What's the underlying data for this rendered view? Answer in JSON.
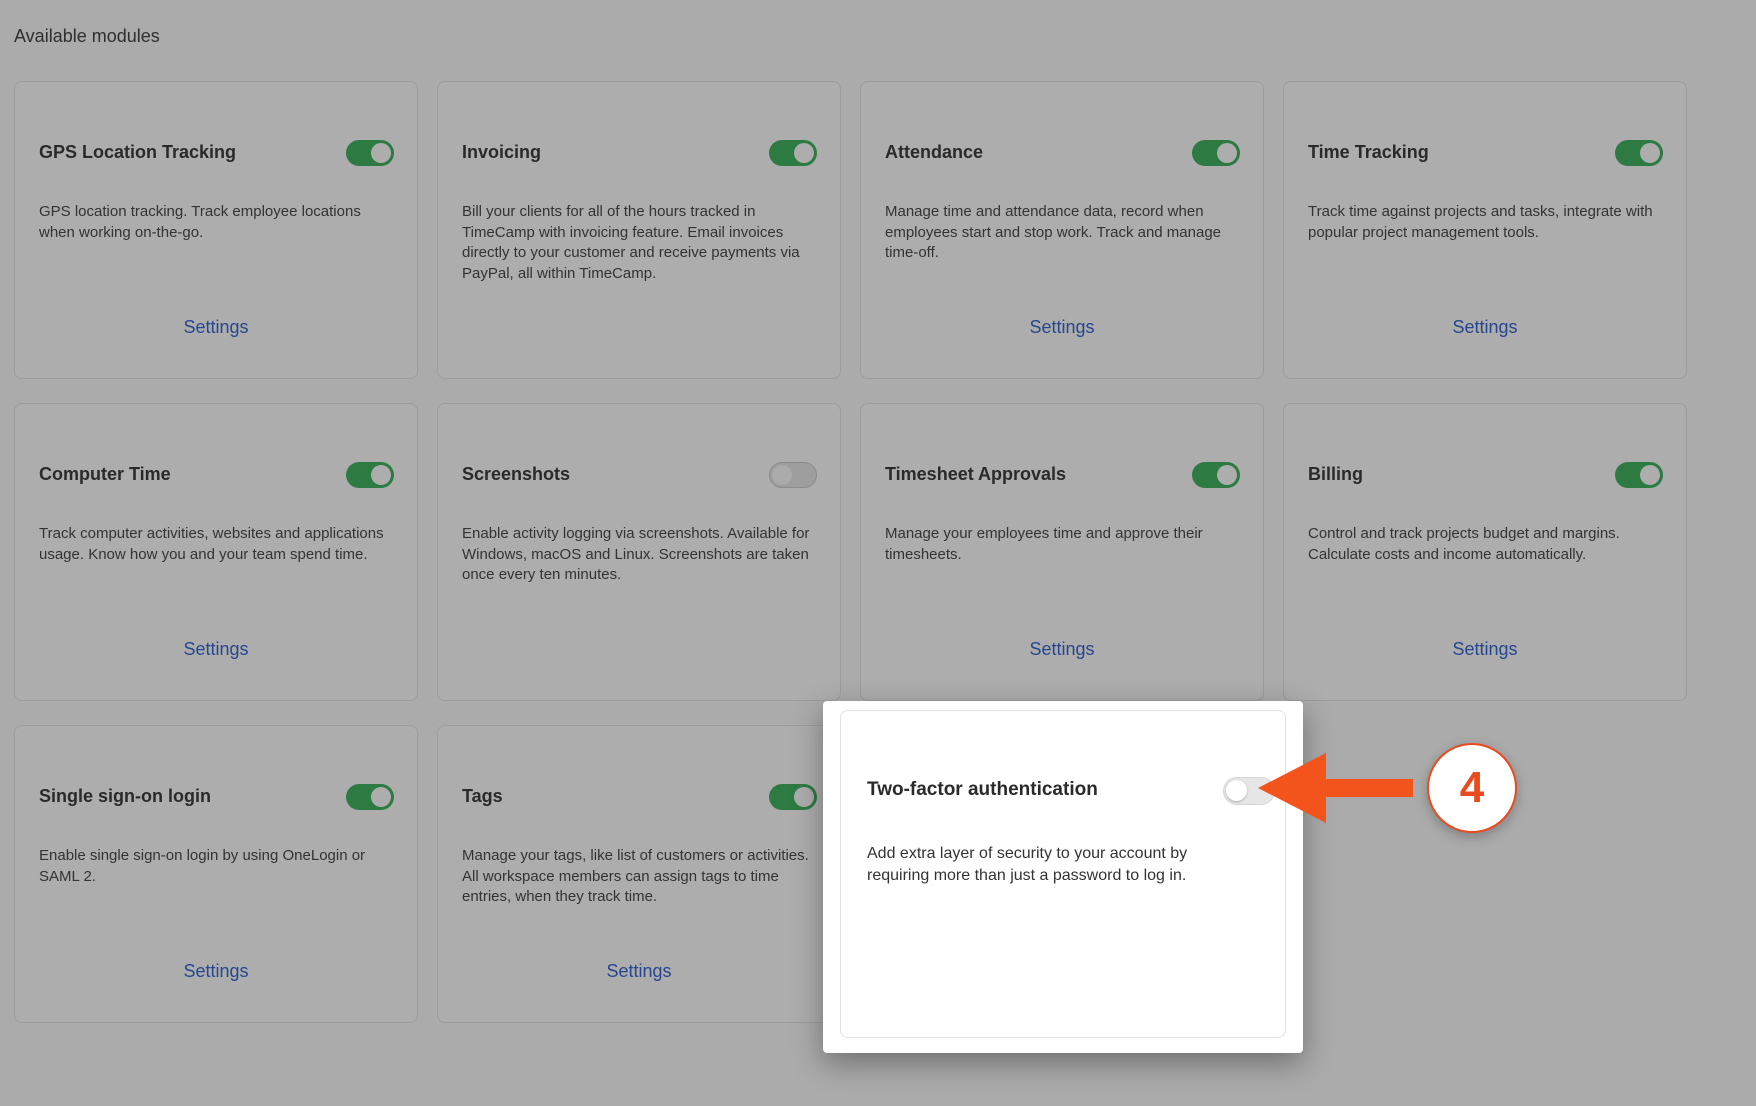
{
  "page": {
    "heading": "Available modules"
  },
  "modules": [
    {
      "title": "GPS Location Tracking",
      "enabled": true,
      "description": "GPS location tracking. Track employee locations when working on-the-go.",
      "settings_label": "Settings"
    },
    {
      "title": "Invoicing",
      "enabled": true,
      "description": "Bill your clients for all of the hours tracked in TimeCamp with invoicing feature. Email invoices directly to your customer and receive payments via PayPal, all within TimeCamp.",
      "settings_label": ""
    },
    {
      "title": "Attendance",
      "enabled": true,
      "description": "Manage time and attendance data, record when employees start and stop work. Track and manage time-off.",
      "settings_label": "Settings"
    },
    {
      "title": "Time Tracking",
      "enabled": true,
      "description": "Track time against projects and tasks, integrate with popular project management tools.",
      "settings_label": "Settings"
    },
    {
      "title": "Computer Time",
      "enabled": true,
      "description": "Track computer activities, websites and applications usage. Know how you and your team spend time.",
      "settings_label": "Settings"
    },
    {
      "title": "Screenshots",
      "enabled": false,
      "description": "Enable activity logging via screenshots. Available for Windows, macOS and Linux. Screenshots are taken once every ten minutes.",
      "settings_label": ""
    },
    {
      "title": "Timesheet Approvals",
      "enabled": true,
      "description": "Manage your employees time and approve their timesheets.",
      "settings_label": "Settings"
    },
    {
      "title": "Billing",
      "enabled": true,
      "description": "Control and track projects budget and margins. Calculate costs and income automatically.",
      "settings_label": "Settings"
    },
    {
      "title": "Single sign-on login",
      "enabled": true,
      "description": "Enable single sign-on login by using OneLogin or SAML 2.",
      "settings_label": "Settings"
    },
    {
      "title": "Tags",
      "enabled": true,
      "description": "Manage your tags, like list of customers or activities. All workspace members can assign tags to time entries, when they track time.",
      "settings_label": "Settings"
    }
  ],
  "highlight": {
    "title": "Two-factor authentication",
    "enabled": false,
    "description": "Add extra layer of security to your account by requiring more than just a password to log in."
  },
  "annotation": {
    "step_number": "4",
    "color": "#e84b1e",
    "arrow_icon": "left-arrow-icon"
  },
  "colors": {
    "toggle_on": "#2d7a43",
    "link": "#26468f",
    "overlay_bg": "#ababab"
  }
}
